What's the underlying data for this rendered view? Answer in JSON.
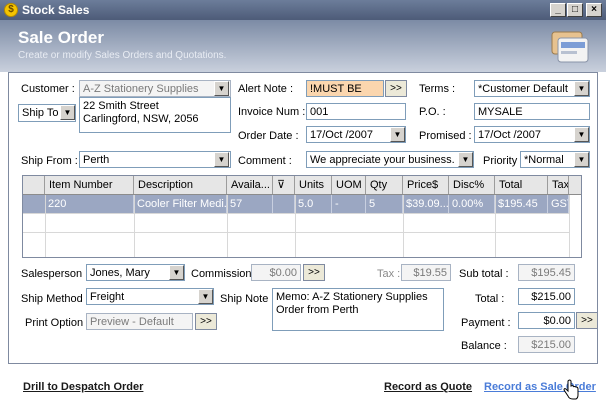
{
  "window": {
    "title": "Stock Sales"
  },
  "header": {
    "title": "Sale Order",
    "subtitle": "Create or modify Sales Orders and Quotations."
  },
  "customer": {
    "label": "Customer :",
    "value": "A-Z Stationery Supplies"
  },
  "ship_to": {
    "label": "Ship To",
    "address_line1": "22 Smith Street",
    "address_line2": "Carlingford, NSW, 2056"
  },
  "alert_note": {
    "label": "Alert Note :",
    "value": "!MUST BE",
    "button": ">>"
  },
  "invoice_num": {
    "label": "Invoice Num :",
    "value": "001"
  },
  "order_date": {
    "label": "Order Date :",
    "value": "17/Oct /2007"
  },
  "terms": {
    "label": "Terms :",
    "value": "*Customer Default"
  },
  "po": {
    "label": "P.O. :",
    "value": "MYSALE"
  },
  "promised": {
    "label": "Promised :",
    "value": "17/Oct /2007"
  },
  "ship_from": {
    "label": "Ship From :",
    "value": "Perth"
  },
  "comment": {
    "label": "Comment :",
    "value": "We appreciate your business."
  },
  "priority": {
    "label": "Priority :",
    "value": "*Normal"
  },
  "grid": {
    "columns": [
      "Item Number",
      "Description",
      "Availa...",
      "",
      "Units",
      "UOM",
      "Qty",
      "Price$",
      "Disc%",
      "Total",
      "Tax"
    ],
    "rows": [
      [
        "220",
        "Cooler Filter Medi...",
        "57",
        "",
        "5.0",
        "-",
        "5",
        "$39.09...",
        "0.00%",
        "$195.45",
        "GST"
      ]
    ]
  },
  "salesperson": {
    "label": "Salesperson :",
    "value": "Jones, Mary"
  },
  "commission": {
    "label": "Commission :",
    "value": "$0.00",
    "button": ">>"
  },
  "tax": {
    "label": "Tax :",
    "value": "$19.55"
  },
  "subtotal": {
    "label": "Sub total :",
    "value": "$195.45"
  },
  "ship_method": {
    "label": "Ship Method :",
    "value": "Freight"
  },
  "ship_note": {
    "label": "Ship Note :",
    "value": "Memo: A-Z Stationery Supplies Order from Perth"
  },
  "total": {
    "label": "Total :",
    "value": "$215.00"
  },
  "print_option": {
    "label": "Print Option :",
    "value": "Preview - Default",
    "button": ">>"
  },
  "payment": {
    "label": "Payment :",
    "value": "$0.00",
    "button": ">>"
  },
  "balance": {
    "label": "Balance :",
    "value": "$215.00"
  },
  "footer": {
    "drill": "Drill to Despatch Order",
    "record_quote": "Record as Quote",
    "record_sale": "Record as Sale Order"
  },
  "colors": {
    "titlebar": "#4d5b78",
    "alert_bg": "#fbd6ae",
    "selected_row": "#9ba7c2",
    "link_blue": "#4a7cd8"
  }
}
